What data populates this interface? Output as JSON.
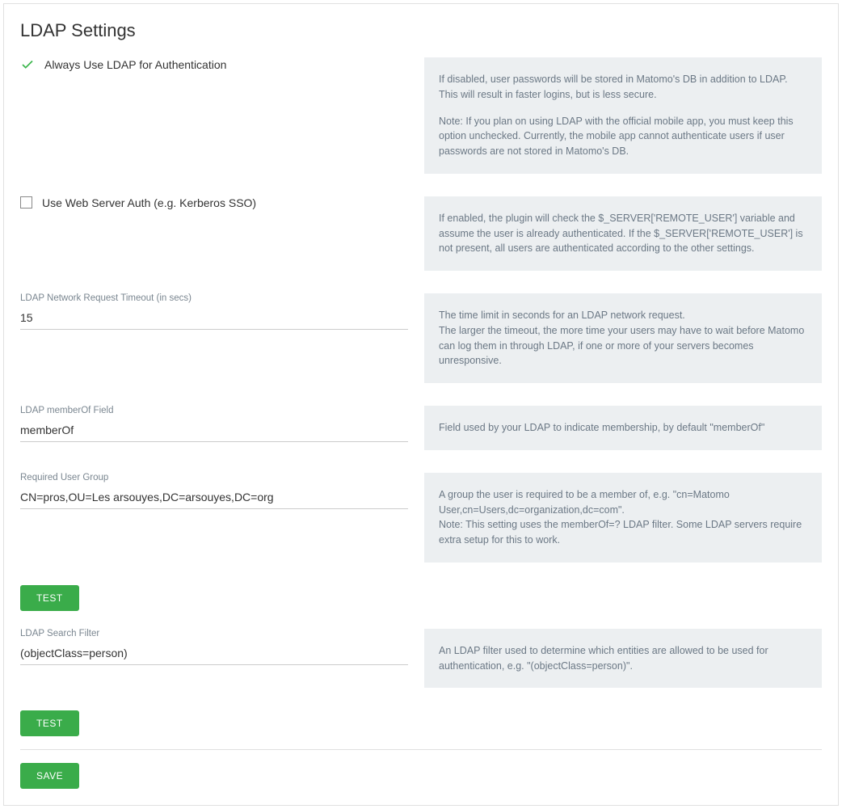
{
  "title": "LDAP Settings",
  "fields": {
    "always_ldap": {
      "label": "Always Use LDAP for Authentication",
      "checked": true,
      "help_p1": "If disabled, user passwords will be stored in Matomo's DB in addition to LDAP. This will result in faster logins, but is less secure.",
      "help_p2": "Note: If you plan on using LDAP with the official mobile app, you must keep this option unchecked. Currently, the mobile app cannot authenticate users if user passwords are not stored in Matomo's DB."
    },
    "web_server_auth": {
      "label": "Use Web Server Auth (e.g. Kerberos SSO)",
      "checked": false,
      "help": "If enabled, the plugin will check the $_SERVER['REMOTE_USER'] variable and assume the user is already authenticated. If the $_SERVER['REMOTE_USER'] is not present, all users are authenticated according to the other settings."
    },
    "timeout": {
      "label": "LDAP Network Request Timeout (in secs)",
      "value": "15",
      "help_l1": "The time limit in seconds for an LDAP network request.",
      "help_l2": "The larger the timeout, the more time your users may have to wait before Matomo can log them in through LDAP, if one or more of your servers becomes unresponsive."
    },
    "memberof": {
      "label": "LDAP memberOf Field",
      "value": "memberOf",
      "help": "Field used by your LDAP to indicate membership, by default \"memberOf\""
    },
    "required_group": {
      "label": "Required User Group",
      "value": "CN=pros,OU=Les arsouyes,DC=arsouyes,DC=org",
      "help_l1": "A group the user is required to be a member of, e.g. \"cn=Matomo User,cn=Users,dc=organization,dc=com\".",
      "help_l2": "Note: This setting uses the memberOf=? LDAP filter. Some LDAP servers require extra setup for this to work."
    },
    "search_filter": {
      "label": "LDAP Search Filter",
      "value": "(objectClass=person)",
      "help": "An LDAP filter used to determine which entities are allowed to be used for authentication, e.g. \"(objectClass=person)\"."
    }
  },
  "buttons": {
    "test": "TEST",
    "save": "SAVE"
  }
}
